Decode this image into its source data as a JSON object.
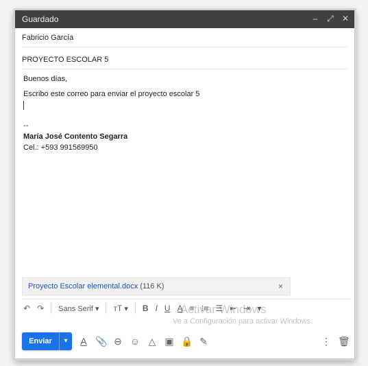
{
  "window": {
    "title": "Guardado",
    "controls": [
      "–",
      "⤢",
      "✕"
    ]
  },
  "recipient": "Fabricio García",
  "subject": "PROYECTO ESCOLAR 5",
  "body": {
    "greeting": "Buenos días,",
    "message": "Escribo este correo para enviar el proyecto escolar 5",
    "sig_dash": "--",
    "signature_name": "María José Contento Segarra",
    "signature_phone": "Cel.: +593 991569950"
  },
  "attachment": {
    "name": "Proyecto Escolar elemental.docx",
    "size": "(116 K)",
    "close": "×"
  },
  "format_toolbar": {
    "undo": "↶",
    "redo": "↷",
    "font": "Sans Serif",
    "font_caret": "▾",
    "size": "тT",
    "size_caret": "▾",
    "bold": "B",
    "italic": "I",
    "underline": "U",
    "text_color": "A",
    "align": "≡",
    "numbered_list": "⁝≡",
    "bullet_list": "☰",
    "indent_less": "⇤",
    "indent_more": "⇥",
    "more": "▾"
  },
  "watermark": {
    "line1": "Activar Windows",
    "line2": "Ve a Configuración para activar Windows."
  },
  "bottom_bar": {
    "send_label": "Enviar",
    "send_caret": "▾",
    "icons": {
      "formatting": "A",
      "attach": "📎",
      "link": "⊖",
      "emoji": "☺",
      "drive": "△",
      "photo": "▣",
      "confidential": "🔒",
      "signature": "✎",
      "more": "⋮",
      "trash": "🗑"
    }
  }
}
